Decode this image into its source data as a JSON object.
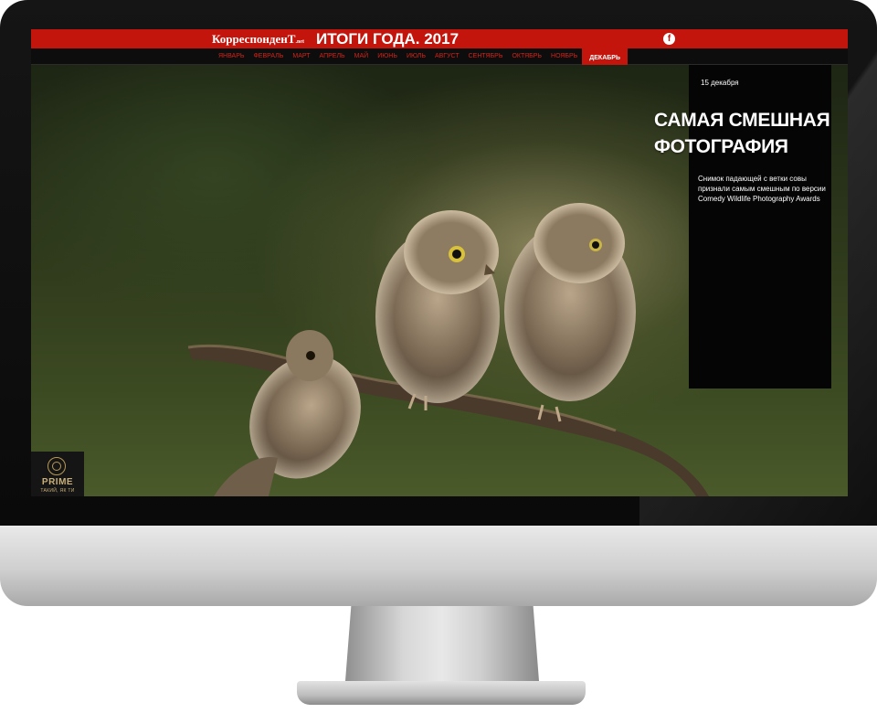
{
  "site": {
    "logo_main": "КорреспонденТ",
    "logo_suffix": ".net",
    "title": "ИТОГИ ГОДА. 2017",
    "social_icon": "facebook-icon",
    "social_glyph": "f"
  },
  "nav": {
    "months": [
      "ЯНВАРЬ",
      "ФЕВРАЛЬ",
      "МАРТ",
      "АПРЕЛЬ",
      "МАЙ",
      "ИЮНЬ",
      "ИЮЛЬ",
      "АВГУСТ",
      "СЕНТЯБРЬ",
      "ОКТЯБРЬ",
      "НОЯБРЬ",
      "ДЕКАБРЬ"
    ],
    "active_month": "ДЕКАБРЬ"
  },
  "story": {
    "date": "15 декабря",
    "headline_line1": "САМАЯ СМЕШНАЯ",
    "headline_line2": "ФОТОГРАФИЯ",
    "description": "Снимок падающей с ветки совы признали самым смешным по версии Comedy Wildlife Photography Awards"
  },
  "badge": {
    "name": "PRIME",
    "tagline": "ТАКИЙ, ЯК ТИ"
  },
  "colors": {
    "brand_red": "#c4150c",
    "nav_text": "#d2241a",
    "panel_bg": "#050505"
  }
}
